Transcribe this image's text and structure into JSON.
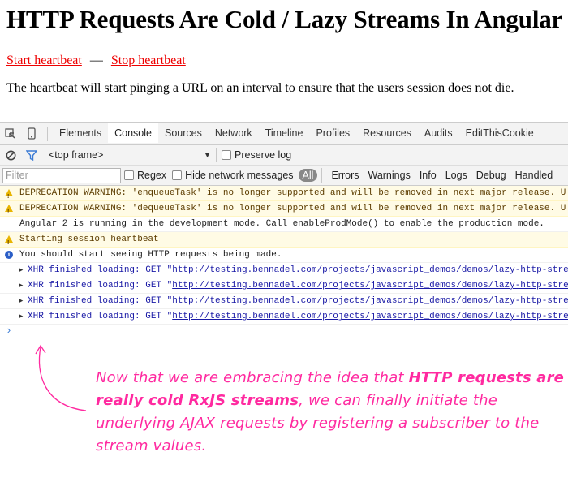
{
  "page": {
    "title": "HTTP Requests Are Cold / Lazy Streams In Angular",
    "start_link": "Start heartbeat",
    "separator": "—",
    "stop_link": "Stop heartbeat",
    "description": "The heartbeat will start pinging a URL on an interval to ensure that the users session does not die."
  },
  "devtools": {
    "tabs": [
      "Elements",
      "Console",
      "Sources",
      "Network",
      "Timeline",
      "Profiles",
      "Resources",
      "Audits",
      "EditThisCookie"
    ],
    "active_tab": "Console",
    "frame_select": "<top frame>",
    "preserve_log": "Preserve log",
    "filter_placeholder": "Filter",
    "regex_label": "Regex",
    "hide_network_label": "Hide network messages",
    "levels": [
      "All",
      "Errors",
      "Warnings",
      "Info",
      "Logs",
      "Debug",
      "Handled"
    ]
  },
  "console": {
    "rows": [
      {
        "kind": "warn",
        "text": "DEPRECATION WARNING: 'enqueueTask' is no longer supported and will be removed in next major release. U"
      },
      {
        "kind": "warn",
        "text": "DEPRECATION WARNING: 'dequeueTask' is no longer supported and will be removed in next major release. U"
      },
      {
        "kind": "plain",
        "text": "Angular 2 is running in the development mode. Call enableProdMode() to enable the production mode."
      },
      {
        "kind": "warn",
        "text": "Starting session heartbeat"
      },
      {
        "kind": "info",
        "text": "You should start seeing HTTP requests being made."
      }
    ],
    "xhr_prefix": "XHR finished loading: GET \"",
    "xhr_url": "http://testing.bennadel.com/projects/javascript_demos/demos/lazy-http-stre",
    "xhr_count": 4
  },
  "annotation": {
    "part1": "Now that we are embracing the idea that ",
    "bold": "HTTP requests are really cold RxJS streams",
    "part2": ", we can finally initiate the underlying AJAX requests by registering a subscriber to the stream values.",
    "color": "#ff2aa0"
  }
}
